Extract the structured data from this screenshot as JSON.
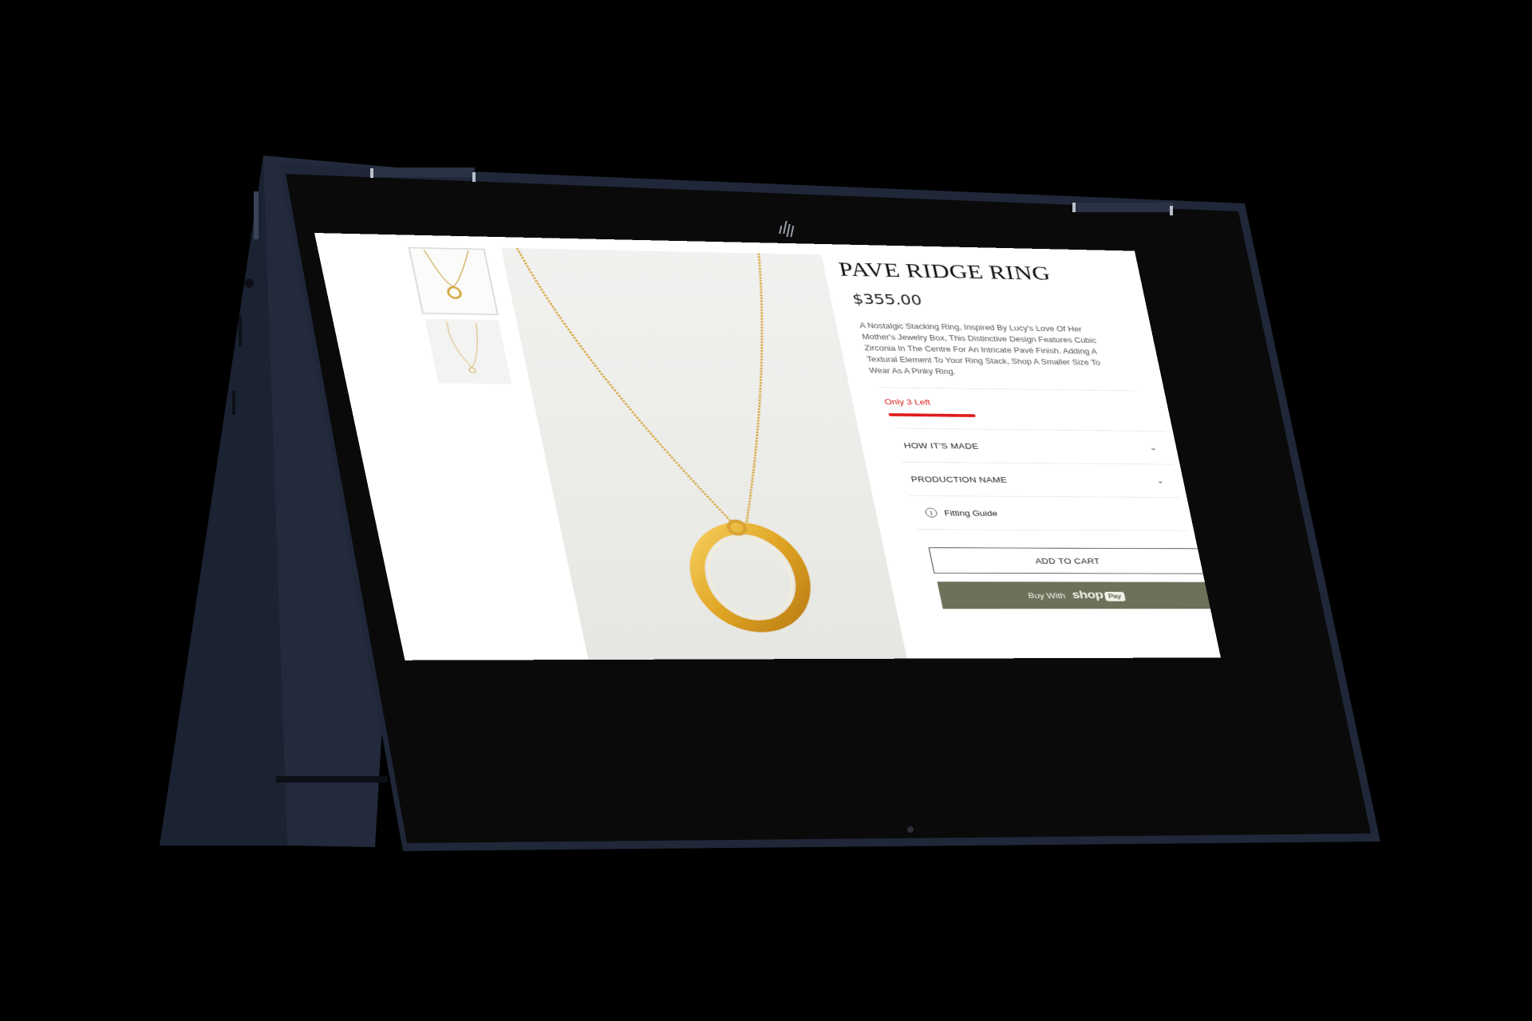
{
  "product": {
    "title": "PAVE RIDGE RING",
    "price": "$355.00",
    "description": "A Nostalgic Stacking Ring, Inspired By Lucy's Love Of Her Mother's Jewelry Box, This Distinctive Design Features Cubic Zirconia In The Centre For An Intricate Pavé Finish. Adding A Textural Element To Your Ring Stack, Shop A Smaller Size To Wear As A Pinky Ring.",
    "stock_label": "Only 3 Left",
    "stock_fraction": 0.3
  },
  "accordion": [
    {
      "label": "HOW IT'S  MADE",
      "icon": "chevron-down-icon"
    },
    {
      "label": "PRODUCTION NAME",
      "icon": "chevron-down-icon"
    }
  ],
  "fitting": {
    "label": "Fitting Guide",
    "icon": "info-icon"
  },
  "actions": {
    "add_to_cart": "ADD TO CART",
    "buy_with": "Buy With",
    "shop_brand": "shop",
    "shop_pay": "Pay"
  },
  "colors": {
    "stock_red": "#e01b1b",
    "shop_pay_bg": "#6e705a",
    "device_body": "#1d2535"
  }
}
